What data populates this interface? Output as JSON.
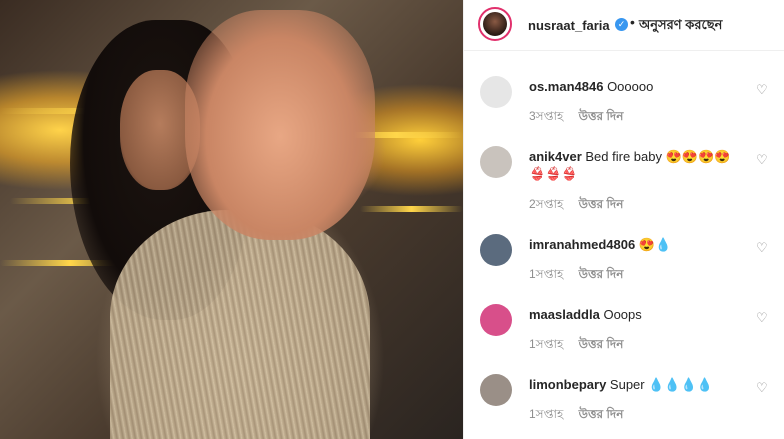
{
  "post": {
    "username": "nusraat_faria",
    "verified_glyph": "✓",
    "dot": "•",
    "follow_status": "অনুসরণ করছেন",
    "photo_icon": "post-photo"
  },
  "comments": [
    {
      "user": "os.man4846",
      "text": "Oooooo",
      "time": "3সপ্তাহ",
      "reply": "উত্তর দিন",
      "avatar_color": "#e6e6e6"
    },
    {
      "user": "anik4ver",
      "text": "Bed fire baby 😍😍😍😍 👙👙👙",
      "time": "2সপ্তাহ",
      "reply": "উত্তর দিন",
      "avatar_color": "#c9c3bd"
    },
    {
      "user": "imranahmed4806",
      "text": "😍💧",
      "time": "1সপ্তাহ",
      "reply": "উত্তর দিন",
      "avatar_color": "#5b6b7e"
    },
    {
      "user": "maasladdla",
      "text": "Ooops",
      "time": "1সপ্তাহ",
      "reply": "উত্তর দিন",
      "avatar_color": "#d84f8a"
    },
    {
      "user": "limonbepary",
      "text": "Super 💧💧💧💧",
      "time": "1সপ্তাহ",
      "reply": "উত্তর দিন",
      "avatar_color": "#9a8f87"
    }
  ],
  "icons": {
    "heart": "♡"
  }
}
